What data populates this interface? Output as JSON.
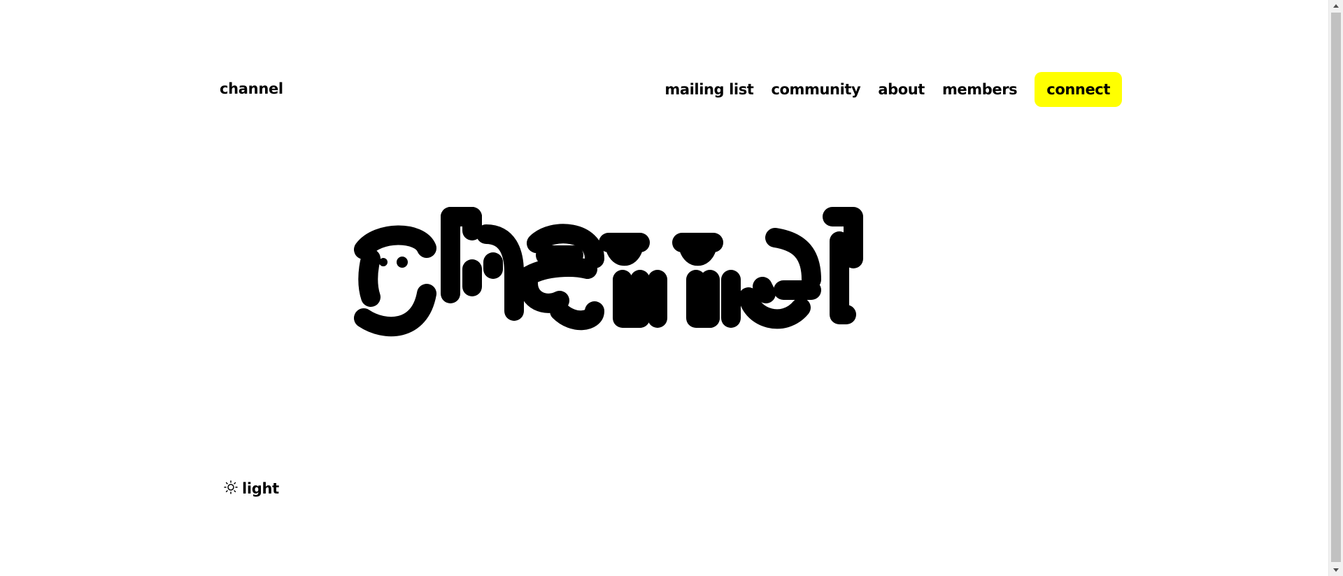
{
  "header": {
    "brand": "channel",
    "nav": [
      "mailing list",
      "community",
      "about",
      "members"
    ],
    "cta": "connect"
  },
  "hero": {
    "logo_text": "channel"
  },
  "theme_toggle": {
    "icon": "sun-icon",
    "label": "light"
  },
  "colors": {
    "accent": "#ffff00",
    "text": "#000000",
    "background": "#ffffff"
  }
}
